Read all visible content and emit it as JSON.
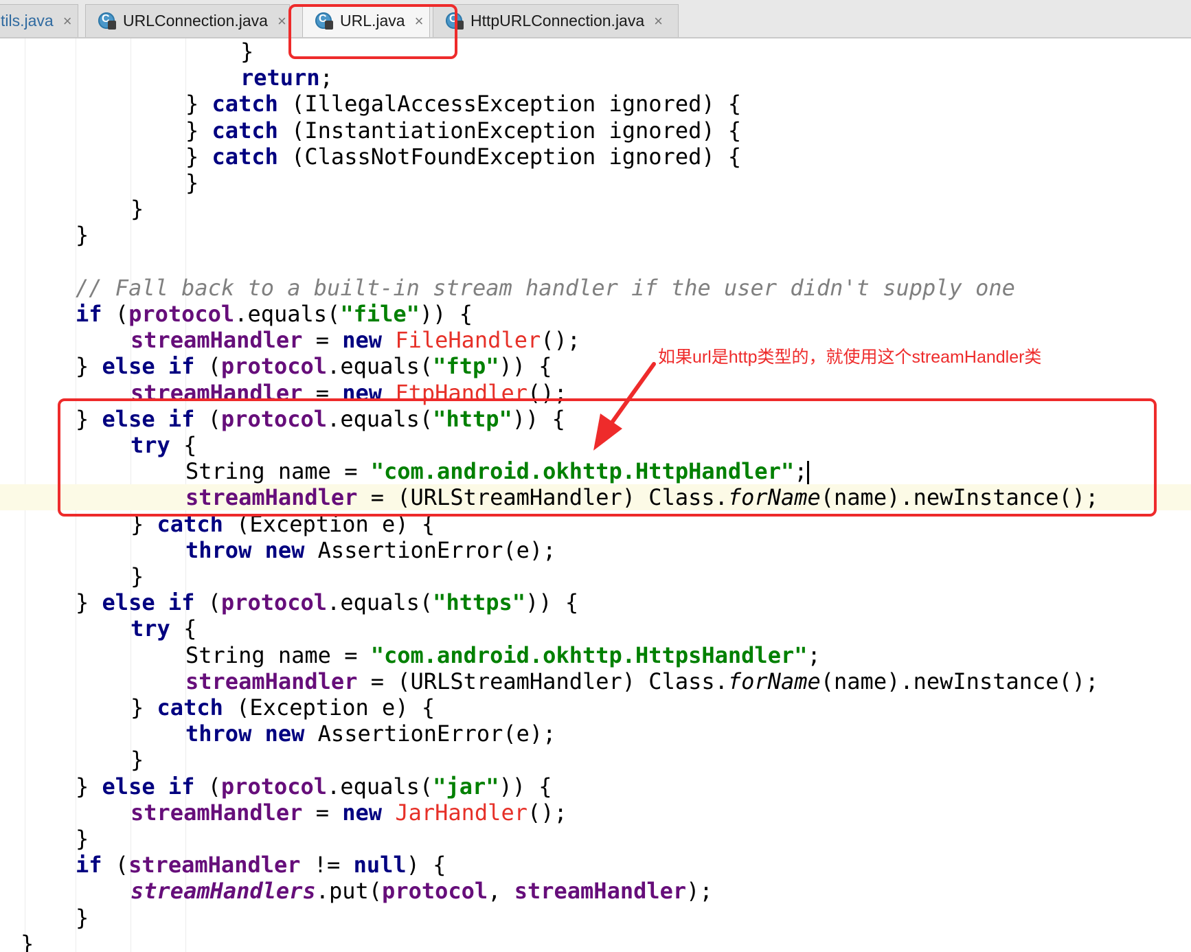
{
  "tabs": [
    {
      "label": "tils.java",
      "close": "×",
      "state": "partial"
    },
    {
      "label": "URLConnection.java",
      "close": "×",
      "icon": "java-class-locked-icon",
      "state": "normal"
    },
    {
      "label": "URL.java",
      "close": "×",
      "icon": "java-class-locked-icon",
      "state": "active"
    },
    {
      "label": "HttpURLConnection.java",
      "close": "×",
      "icon": "java-class-locked-icon",
      "state": "normal"
    }
  ],
  "tab_icon_letter": "C",
  "colors": {
    "keyword": "#000080",
    "field": "#660e7a",
    "string": "#008000",
    "class_ref": "#e63028",
    "comment": "#808080",
    "annotation": "#ee2b2b",
    "current_line": "#fcfae6"
  },
  "annotation": {
    "note": "如果url是http类型的，就使用这个streamHandler类"
  },
  "code": {
    "current_line_index": 17,
    "lines": [
      {
        "indent": 6,
        "tokens": [
          [
            "}",
            ""
          ]
        ]
      },
      {
        "indent": 6,
        "tokens": [
          [
            "return",
            "kw"
          ],
          [
            ";",
            ""
          ]
        ]
      },
      {
        "indent": 4,
        "tokens": [
          [
            "} ",
            ""
          ],
          [
            "catch",
            "kw"
          ],
          [
            " (IllegalAccessException ignored) {",
            ""
          ]
        ]
      },
      {
        "indent": 4,
        "tokens": [
          [
            "} ",
            ""
          ],
          [
            "catch",
            "kw"
          ],
          [
            " (InstantiationException ignored) {",
            ""
          ]
        ]
      },
      {
        "indent": 4,
        "tokens": [
          [
            "} ",
            ""
          ],
          [
            "catch",
            "kw"
          ],
          [
            " (ClassNotFoundException ignored) {",
            ""
          ]
        ]
      },
      {
        "indent": 4,
        "tokens": [
          [
            "}",
            ""
          ]
        ]
      },
      {
        "indent": 2,
        "tokens": [
          [
            "}",
            ""
          ]
        ]
      },
      {
        "indent": 0,
        "tokens": [
          [
            "}",
            ""
          ]
        ]
      },
      {
        "indent": 0,
        "tokens": []
      },
      {
        "indent": 0,
        "tokens": [
          [
            "// Fall back to a built-in stream handler if the user didn't supply one",
            "comment"
          ]
        ]
      },
      {
        "indent": 0,
        "tokens": [
          [
            "if",
            "kw"
          ],
          [
            " (",
            ""
          ],
          [
            "protocol",
            "field"
          ],
          [
            ".equals(",
            ""
          ],
          [
            "\"file\"",
            "str"
          ],
          [
            ")) {",
            ""
          ]
        ]
      },
      {
        "indent": 2,
        "tokens": [
          [
            "streamHandler",
            "field"
          ],
          [
            " = ",
            ""
          ],
          [
            "new",
            "kw"
          ],
          [
            " ",
            ""
          ],
          [
            "FileHandler",
            "cls"
          ],
          [
            "();",
            ""
          ]
        ]
      },
      {
        "indent": 0,
        "tokens": [
          [
            "} ",
            ""
          ],
          [
            "else",
            "kw"
          ],
          [
            " ",
            ""
          ],
          [
            "if",
            "kw"
          ],
          [
            " (",
            ""
          ],
          [
            "protocol",
            "field"
          ],
          [
            ".equals(",
            ""
          ],
          [
            "\"ftp\"",
            "str"
          ],
          [
            ")) {",
            ""
          ]
        ]
      },
      {
        "indent": 2,
        "tokens": [
          [
            "streamHandler",
            "field"
          ],
          [
            " = ",
            ""
          ],
          [
            "new",
            "kw"
          ],
          [
            " ",
            ""
          ],
          [
            "FtpHandler",
            "cls"
          ],
          [
            "();",
            ""
          ]
        ]
      },
      {
        "indent": 0,
        "tokens": [
          [
            "} ",
            ""
          ],
          [
            "else",
            "kw"
          ],
          [
            " ",
            ""
          ],
          [
            "if",
            "kw"
          ],
          [
            " (",
            ""
          ],
          [
            "protocol",
            "field"
          ],
          [
            ".equals(",
            ""
          ],
          [
            "\"http\"",
            "str"
          ],
          [
            ")) {",
            ""
          ]
        ]
      },
      {
        "indent": 2,
        "tokens": [
          [
            "try",
            "kw"
          ],
          [
            " {",
            ""
          ]
        ]
      },
      {
        "indent": 4,
        "tokens": [
          [
            "String name = ",
            ""
          ],
          [
            "\"com.android.okhttp.HttpHandler\"",
            "str"
          ],
          [
            ";",
            ""
          ]
        ],
        "caret": true
      },
      {
        "indent": 4,
        "tokens": [
          [
            "streamHandler",
            "field"
          ],
          [
            " = (URLStreamHandler) Class.",
            ""
          ],
          [
            "forName",
            "italic"
          ],
          [
            "(name).newInstance();",
            ""
          ]
        ]
      },
      {
        "indent": 2,
        "tokens": [
          [
            "} ",
            ""
          ],
          [
            "catch",
            "kw"
          ],
          [
            " (Exception e) {",
            ""
          ]
        ]
      },
      {
        "indent": 4,
        "tokens": [
          [
            "throw",
            "kw"
          ],
          [
            " ",
            ""
          ],
          [
            "new",
            "kw"
          ],
          [
            " AssertionError(e);",
            ""
          ]
        ]
      },
      {
        "indent": 2,
        "tokens": [
          [
            "}",
            ""
          ]
        ]
      },
      {
        "indent": 0,
        "tokens": [
          [
            "} ",
            ""
          ],
          [
            "else",
            "kw"
          ],
          [
            " ",
            ""
          ],
          [
            "if",
            "kw"
          ],
          [
            " (",
            ""
          ],
          [
            "protocol",
            "field"
          ],
          [
            ".equals(",
            ""
          ],
          [
            "\"https\"",
            "str"
          ],
          [
            ")) {",
            ""
          ]
        ]
      },
      {
        "indent": 2,
        "tokens": [
          [
            "try",
            "kw"
          ],
          [
            " {",
            ""
          ]
        ]
      },
      {
        "indent": 4,
        "tokens": [
          [
            "String name = ",
            ""
          ],
          [
            "\"com.android.okhttp.HttpsHandler\"",
            "str"
          ],
          [
            ";",
            ""
          ]
        ]
      },
      {
        "indent": 4,
        "tokens": [
          [
            "streamHandler",
            "field"
          ],
          [
            " = (URLStreamHandler) Class.",
            ""
          ],
          [
            "forName",
            "italic"
          ],
          [
            "(name).newInstance();",
            ""
          ]
        ]
      },
      {
        "indent": 2,
        "tokens": [
          [
            "} ",
            ""
          ],
          [
            "catch",
            "kw"
          ],
          [
            " (Exception e) {",
            ""
          ]
        ]
      },
      {
        "indent": 4,
        "tokens": [
          [
            "throw",
            "kw"
          ],
          [
            " ",
            ""
          ],
          [
            "new",
            "kw"
          ],
          [
            " AssertionError(e);",
            ""
          ]
        ]
      },
      {
        "indent": 2,
        "tokens": [
          [
            "}",
            ""
          ]
        ]
      },
      {
        "indent": 0,
        "tokens": [
          [
            "} ",
            ""
          ],
          [
            "else",
            "kw"
          ],
          [
            " ",
            ""
          ],
          [
            "if",
            "kw"
          ],
          [
            " (",
            ""
          ],
          [
            "protocol",
            "field"
          ],
          [
            ".equals(",
            ""
          ],
          [
            "\"jar\"",
            "str"
          ],
          [
            ")) {",
            ""
          ]
        ]
      },
      {
        "indent": 2,
        "tokens": [
          [
            "streamHandler",
            "field"
          ],
          [
            " = ",
            ""
          ],
          [
            "new",
            "kw"
          ],
          [
            " ",
            ""
          ],
          [
            "JarHandler",
            "cls"
          ],
          [
            "();",
            ""
          ]
        ]
      },
      {
        "indent": 0,
        "tokens": [
          [
            "}",
            ""
          ]
        ]
      },
      {
        "indent": 0,
        "tokens": [
          [
            "if",
            "kw"
          ],
          [
            " (",
            ""
          ],
          [
            "streamHandler",
            "field"
          ],
          [
            " != ",
            ""
          ],
          [
            "null",
            "kw"
          ],
          [
            ") {",
            ""
          ]
        ]
      },
      {
        "indent": 2,
        "tokens": [
          [
            "streamHandlers",
            "field-italic"
          ],
          [
            ".put(",
            ""
          ],
          [
            "protocol",
            "field"
          ],
          [
            ", ",
            ""
          ],
          [
            "streamHandler",
            "field"
          ],
          [
            ");",
            ""
          ]
        ]
      },
      {
        "indent": 0,
        "tokens": [
          [
            "}",
            ""
          ]
        ]
      },
      {
        "indent": -2,
        "tokens": [
          [
            "}",
            ""
          ]
        ]
      }
    ]
  }
}
